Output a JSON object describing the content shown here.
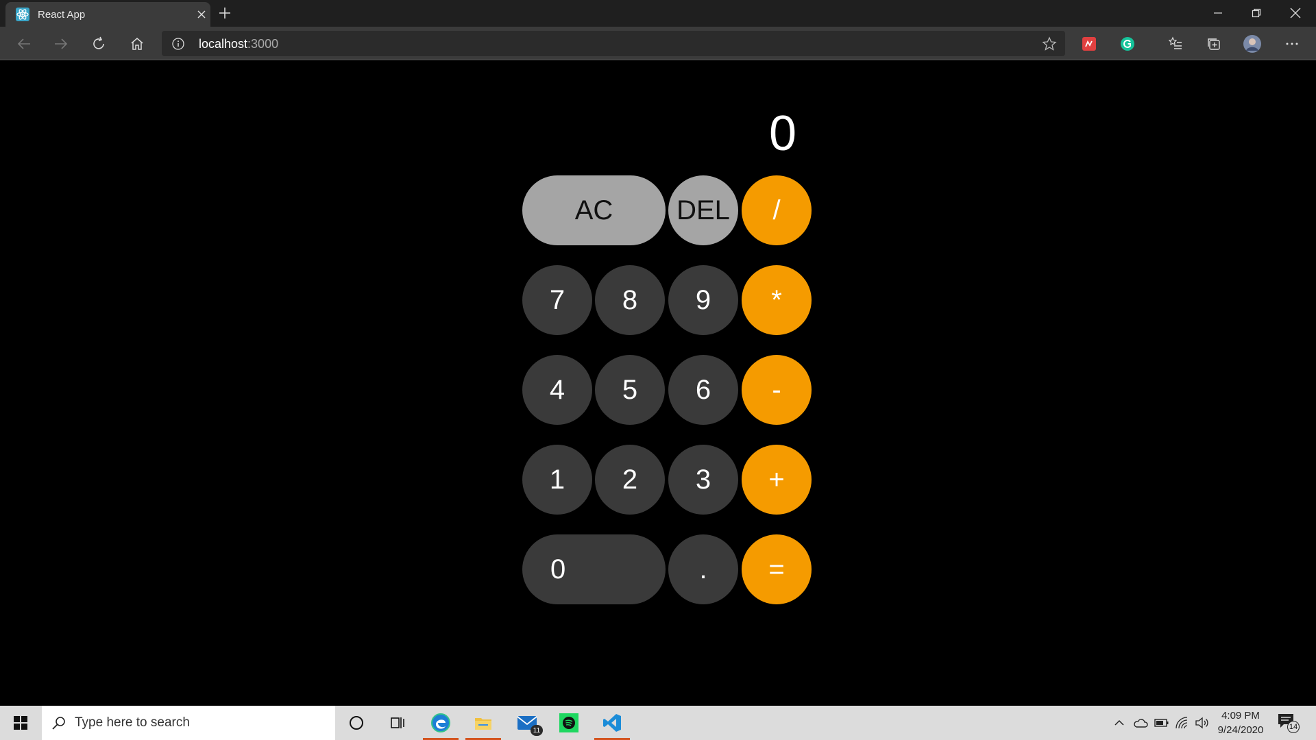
{
  "browser": {
    "tab": {
      "title": "React App",
      "favicon": "react-logo-icon"
    },
    "address": {
      "host": "localhost",
      "port": ":3000"
    }
  },
  "calculator": {
    "display": "0",
    "keys": {
      "ac": "AC",
      "del": "DEL",
      "divide": "/",
      "seven": "7",
      "eight": "8",
      "nine": "9",
      "multiply": "*",
      "four": "4",
      "five": "5",
      "six": "6",
      "subtract": "-",
      "one": "1",
      "two": "2",
      "three": "3",
      "add": "+",
      "zero": "0",
      "decimal": ".",
      "equals": "="
    },
    "colors": {
      "function": "#a5a5a5",
      "digit": "#3a3a3a",
      "operator": "#f59b00"
    }
  },
  "taskbar": {
    "search_placeholder": "Type here to search",
    "mail_badge": "11",
    "clock": {
      "time": "4:09 PM",
      "date": "9/24/2020"
    },
    "notification_count": "14"
  }
}
